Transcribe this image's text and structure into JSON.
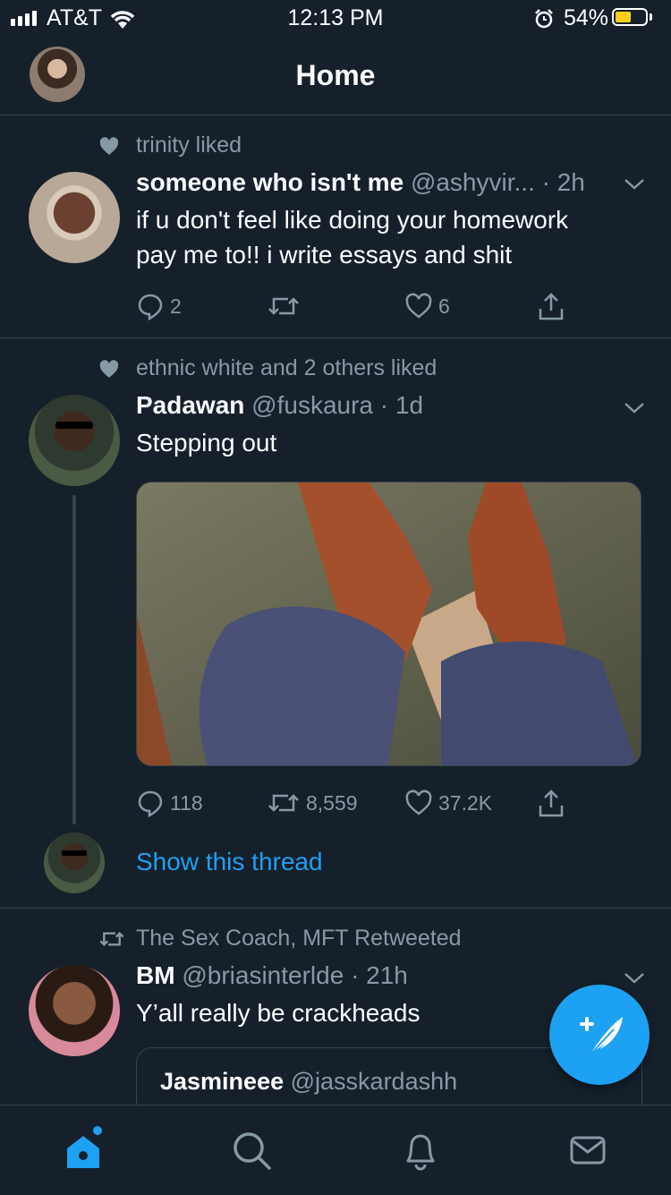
{
  "status_bar": {
    "carrier": "AT&T",
    "time": "12:13 PM",
    "battery_percent": "54%",
    "battery_level": 0.54
  },
  "header": {
    "title": "Home"
  },
  "tweets": [
    {
      "context": "trinity liked",
      "context_icon": "heart-icon",
      "name": "someone who isn't me",
      "handle": "@ashyvir...",
      "time": "· 2h",
      "text_lines": [
        "if u don't feel like doing your homework",
        "pay me to!! i write essays and shit"
      ],
      "replies": "2",
      "retweets": "",
      "likes": "6"
    },
    {
      "context": "ethnic white and 2 others liked",
      "context_icon": "heart-icon",
      "name": "Padawan",
      "handle": "@fuskaura",
      "time": "· 1d",
      "text": "Stepping out",
      "replies": "118",
      "retweets": "8,559",
      "likes": "37.2K",
      "show_thread": "Show this thread"
    },
    {
      "context": "The Sex Coach, MFT Retweeted",
      "context_icon": "retweet-icon",
      "name": "BM",
      "handle": "@briasinterlde",
      "time": "· 21h",
      "text": "Y’all really be crackheads",
      "quote": {
        "name": "Jasmineee",
        "handle": "@jasskardashh"
      }
    }
  ],
  "tab_bar": {
    "tabs": [
      "home-icon",
      "search-icon",
      "bell-icon",
      "mail-icon"
    ],
    "active": "home-icon"
  },
  "colors": {
    "background": "#15202b",
    "divider": "#38444d",
    "muted": "#8899a6",
    "accent": "#1da1f2"
  }
}
